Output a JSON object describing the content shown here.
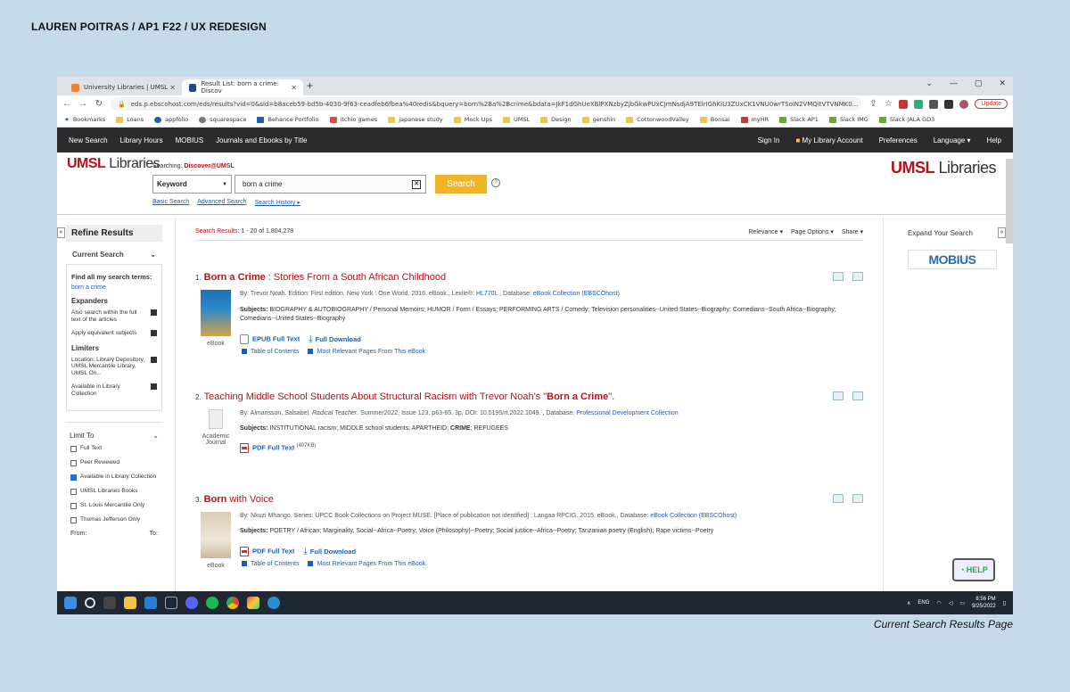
{
  "page_header": "LAUREN POITRAS / AP1 F22 / UX REDESIGN",
  "page_caption": "Current Search Results Page",
  "browser": {
    "tabs": [
      {
        "label": "University Libraries | UMSL"
      },
      {
        "label": "Result List: born a crime: Discov"
      }
    ],
    "url": "eds.p.ebscohost.com/eds/results?vid=0&sid=b8aceb59-bd5b-4030-9f63-ceadfeb6fbea%40redis&bquery=born%2Ba%2Bcrime&bdata=JkF1dGhUeXBlPXNzbyZjbGkwPUxCJmNsdjA9TElrIGhKiU3ZUxCK1VNU0wrTSoiN2VMQitVTVNMK0...",
    "update_label": "Update",
    "bookmarks": [
      "Bookmarks",
      "Loans",
      "appfolio",
      "squarespace",
      "Behance Portfolio",
      "itchio games",
      "japanese study",
      "Mock Ups",
      "UMSL",
      "Design",
      "genshin",
      "CottonwoodValley",
      "Bonsai",
      "myHR",
      "Slack AP1",
      "Slack IMG",
      "Slack |ALA GD3"
    ]
  },
  "sitenav": {
    "left": [
      "New Search",
      "Library Hours",
      "MOBIUS",
      "Journals and Ebooks by Title"
    ],
    "right": [
      "Sign In",
      "My Library Account",
      "Preferences",
      "Language ▾",
      "Help"
    ]
  },
  "search": {
    "logo_umsl": "UMSL",
    "logo_lib": "Libraries",
    "searching_label": "Searching:",
    "searching_db": "Discover@UMSL",
    "field": "Keyword",
    "query": "born a crime",
    "button": "Search",
    "links": [
      "Basic Search",
      "Advanced Search",
      "Search History ▸"
    ]
  },
  "left": {
    "refine_title": "Refine Results",
    "current_search": "Current Search",
    "find_all": "Find all my search terms:",
    "term": "born a crime",
    "expanders_title": "Expanders",
    "expanders": [
      "Also search within the full text of the articles",
      "Apply equivalent subjects"
    ],
    "limiters_title": "Limiters",
    "limiters": [
      "Location: Library Depository, UMSL Mercantile Library, UMSL On...",
      "Available in Library Collection"
    ],
    "limit_to_title": "Limit To",
    "limit_to": [
      {
        "label": "Full Text",
        "checked": false
      },
      {
        "label": "Peer Reviewed",
        "checked": false
      },
      {
        "label": "Available in Library Collection",
        "checked": true
      },
      {
        "label": "UMSL Libraries Books",
        "checked": false
      },
      {
        "label": "St. Louis Mercantile Only",
        "checked": false
      },
      {
        "label": "Thomas Jefferson Only",
        "checked": false
      }
    ],
    "from_label": "From:",
    "to_label": "To:"
  },
  "results": {
    "label": "Search Results:",
    "range": "1 - 20 of 1,804,278",
    "options": [
      "Relevance ▾",
      "Page Options ▾",
      "Share ▾"
    ],
    "items": [
      {
        "num": "1.",
        "title_bold": "Born a Crime",
        "title_rest": " : Stories From a South African Childhood",
        "meta": "By: Trevor Noah. Edition: First edition. New York : One World. 2016. eBook., Lexile®: ",
        "lexile": "HL770L",
        "db_label": " , Database: ",
        "db": "eBook Collection (EBSCOhost)",
        "subjects_label": "Subjects:",
        "subjects": "BIOGRAPHY & AUTOBIOGRAPHY / Personal Memoirs; HUMOR / Form / Essays; PERFORMING ARTS / Comedy; Television personalities--United States--Biography; Comedians--South Africa--Biography; Comedians--United States--Biography",
        "type": "eBook",
        "link1": "EPUB Full Text",
        "link2": "Full Download",
        "sub1": "Table of Contents",
        "sub2": "Most Relevant Pages From This eBook"
      },
      {
        "num": "2.",
        "title_pre": "Teaching Middle School Students About Structural Racism with Trevor Noah's \"",
        "title_bold": "Born a Crime",
        "title_post": "\".",
        "meta_pre": "By: Almansson, Salsabel. ",
        "meta_journal": "Radical Teacher",
        "meta": ". Summer2022, Issue 123, p63-65. 3p. DOI: 10.5195/rt.2022.1049. , Database: ",
        "db": "Professional Development Collection",
        "subjects_label": "Subjects:",
        "subjects_pre": "INSTITUTIONAL racism; MIDDLE school students; APARTHEID; ",
        "subjects_bold": "CRIME",
        "subjects_post": "; REFUGEES",
        "type": "Academic Journal",
        "link1": "PDF Full Text",
        "link1_size": "(407KB)"
      },
      {
        "num": "3.",
        "title_bold": "Born",
        "title_rest": " with Voice",
        "meta": "By: Nkuzi Mhango. Series: UPCC Book Collections on Project MUSE. [Place of publication not identified] : Langaa RPCIG. 2015. eBook., Database: ",
        "db": "eBook Collection (EBSCOhost)",
        "subjects_label": "Subjects:",
        "subjects": "POETRY / African; Marginality, Social--Africa--Poetry; Voice (Philosophy)--Poetry; Social justice--Africa--Poetry; Tanzanian poetry (English); Rape victims--Poetry",
        "type": "eBook",
        "link1": "PDF Full Text",
        "link2": "Full Download",
        "sub1": "Table of Contents",
        "sub2": "Most Relevant Pages From This eBook"
      }
    ]
  },
  "right": {
    "expand_title": "Expand Your Search",
    "mobius": "MOBIUS"
  },
  "help_widget": "HELP",
  "taskbar": {
    "lang": "ENG",
    "time": "8:56 PM",
    "date": "9/25/2022"
  }
}
